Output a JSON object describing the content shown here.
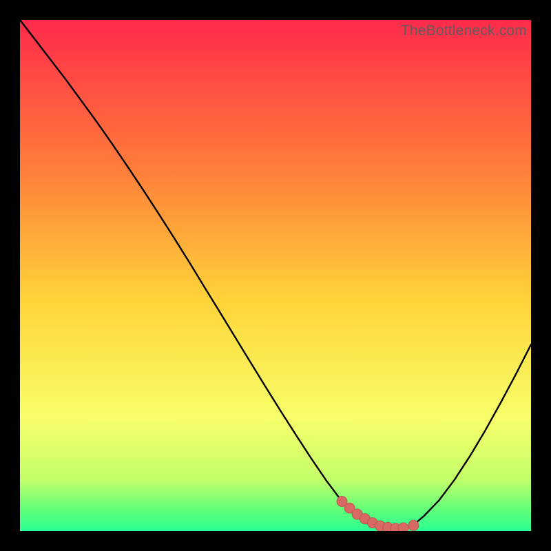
{
  "watermark": "TheBottleneck.com",
  "colors": {
    "gradient_top": "#ff2a4b",
    "gradient_mid_upper": "#ff7a3a",
    "gradient_mid": "#ffd43a",
    "gradient_mid_lower": "#f8ff6a",
    "gradient_green1": "#c2ff6a",
    "gradient_green2": "#5fff7a",
    "gradient_green3": "#2bff93",
    "curve": "#000000",
    "marker_fill": "#d96a63",
    "marker_stroke": "#c2544e"
  },
  "chart_data": {
    "type": "line",
    "title": "",
    "xlabel": "",
    "ylabel": "",
    "xlim": [
      0,
      100
    ],
    "ylim": [
      0,
      100
    ],
    "series": [
      {
        "name": "bottleneck-curve",
        "x": [
          0,
          3,
          6,
          9,
          12,
          15,
          18,
          21,
          24,
          27,
          30,
          33,
          36,
          39,
          42,
          45,
          48,
          51,
          54,
          57,
          60,
          63,
          65,
          67,
          69,
          71,
          73,
          75,
          77,
          79,
          82,
          85,
          88,
          91,
          94,
          97,
          100
        ],
        "y": [
          100,
          96.1,
          92.2,
          88.3,
          84.2,
          80.1,
          75.8,
          71.4,
          66.9,
          62.3,
          57.6,
          52.8,
          47.9,
          43.0,
          38.1,
          33.2,
          28.3,
          23.5,
          18.8,
          14.2,
          9.8,
          5.8,
          3.6,
          2.0,
          1.0,
          0.5,
          0.4,
          0.5,
          1.2,
          2.9,
          6.0,
          10.0,
          14.6,
          19.6,
          25.0,
          30.6,
          36.5
        ]
      }
    ],
    "markers": {
      "name": "optimal-band",
      "x": [
        63.0,
        64.5,
        66.0,
        67.5,
        69.0,
        70.5,
        72.0,
        73.5,
        75.0,
        77.0
      ],
      "y": [
        5.8,
        4.5,
        3.3,
        2.4,
        1.6,
        1.0,
        0.7,
        0.5,
        0.6,
        1.1
      ]
    }
  }
}
